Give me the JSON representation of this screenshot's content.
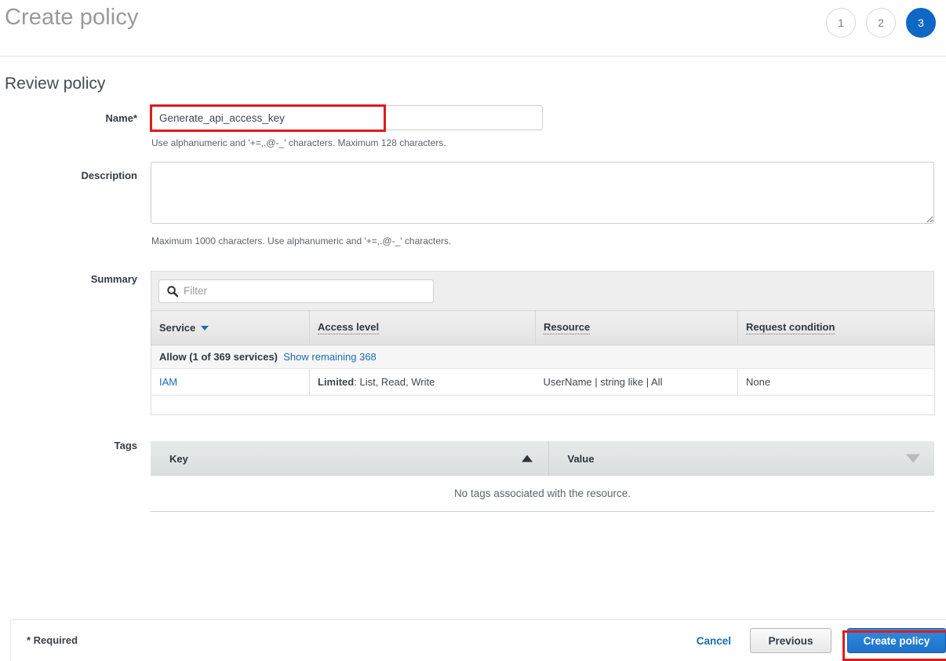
{
  "header": {
    "title": "Create policy",
    "steps": [
      {
        "label": "1",
        "active": false
      },
      {
        "label": "2",
        "active": false
      },
      {
        "label": "3",
        "active": true
      }
    ]
  },
  "colors": {
    "accent_blue": "#0e68c4",
    "link_blue": "#1b6cb3",
    "annotation_red": "#e01b1b",
    "primary_button": "#1f72c9"
  },
  "main": {
    "section_title": "Review policy",
    "fields": {
      "name": {
        "label": "Name*",
        "value": "Generate_api_access_key",
        "placeholder": "",
        "helper": "Use alphanumeric and '+=,.@-_' characters. Maximum 128 characters."
      },
      "description": {
        "label": "Description",
        "value": "",
        "placeholder": "",
        "helper": "Maximum 1000 characters. Use alphanumeric and '+=,.@-_' characters."
      }
    },
    "summary": {
      "label": "Summary",
      "filter_placeholder": "Filter",
      "filter_value": "",
      "filter_icon": "search-icon",
      "columns": [
        {
          "label": "Service",
          "sort": "descending",
          "sort_icon": "caret-down-icon",
          "tooltip": false
        },
        {
          "label": "Access level",
          "sort": "none",
          "tooltip": true
        },
        {
          "label": "Resource",
          "sort": "none",
          "tooltip": true
        },
        {
          "label": "Request condition",
          "sort": "none",
          "tooltip": true
        }
      ],
      "group": {
        "effect": "Allow (1 of 369 services)",
        "show_remaining_link": "Show remaining 368"
      },
      "rows": [
        {
          "service": "IAM",
          "access_level_prefix": "Limited",
          "access_level": ": List, Read, Write",
          "resource": "UserName | string like | All",
          "request_condition": "None"
        }
      ]
    },
    "tags": {
      "label": "Tags",
      "columns": [
        {
          "label": "Key",
          "sort": "ascending",
          "sort_icon": "triangle-up-icon"
        },
        {
          "label": "Value",
          "sort": "none",
          "sort_icon": "triangle-down-icon"
        }
      ],
      "empty_message": "No tags associated with the resource."
    }
  },
  "footer": {
    "required_note": "* Required",
    "cancel_label": "Cancel",
    "previous_label": "Previous",
    "create_label": "Create policy"
  }
}
